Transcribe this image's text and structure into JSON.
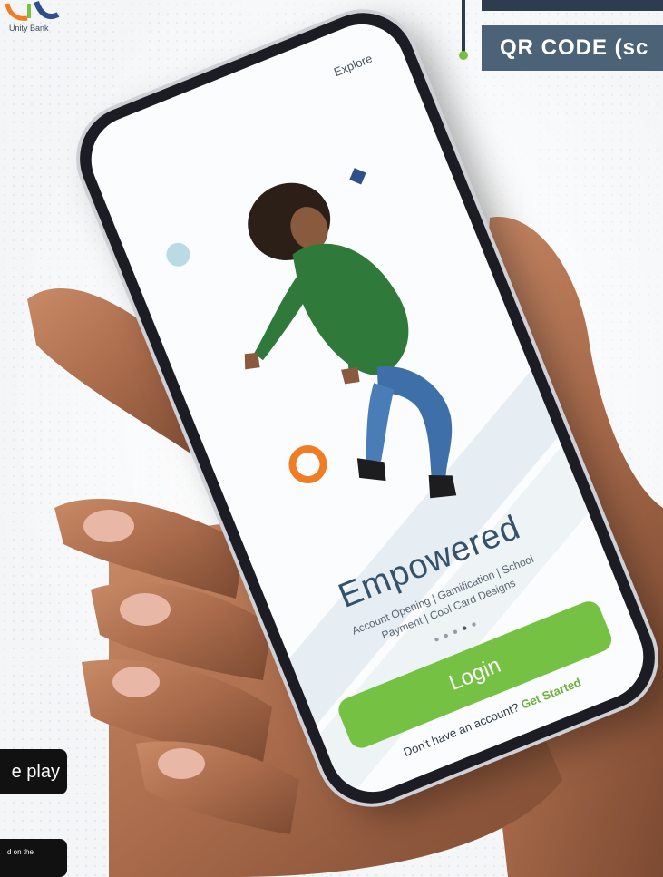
{
  "brand": {
    "logo_text": "Unity Bank"
  },
  "qr_banner": {
    "label": "QR CODE (sc"
  },
  "badges": {
    "google_play_label": "e play",
    "app_store_label": "d on the"
  },
  "phone_screen": {
    "explore_label": "Explore",
    "headline": "Empowered",
    "tagline_line1": "Account Opening | Gamification | School",
    "tagline_line2": "Payment | Cool Card Designs",
    "login_label": "Login",
    "signup_prompt": "Don't have an account?",
    "signup_link": "Get Started",
    "pagination_active_index": 4,
    "pagination_count": 5
  },
  "colors": {
    "accent_green": "#75c143",
    "banner_slate": "#4c6377",
    "headline_blue": "#35526a",
    "ring_orange": "#f07c24"
  }
}
